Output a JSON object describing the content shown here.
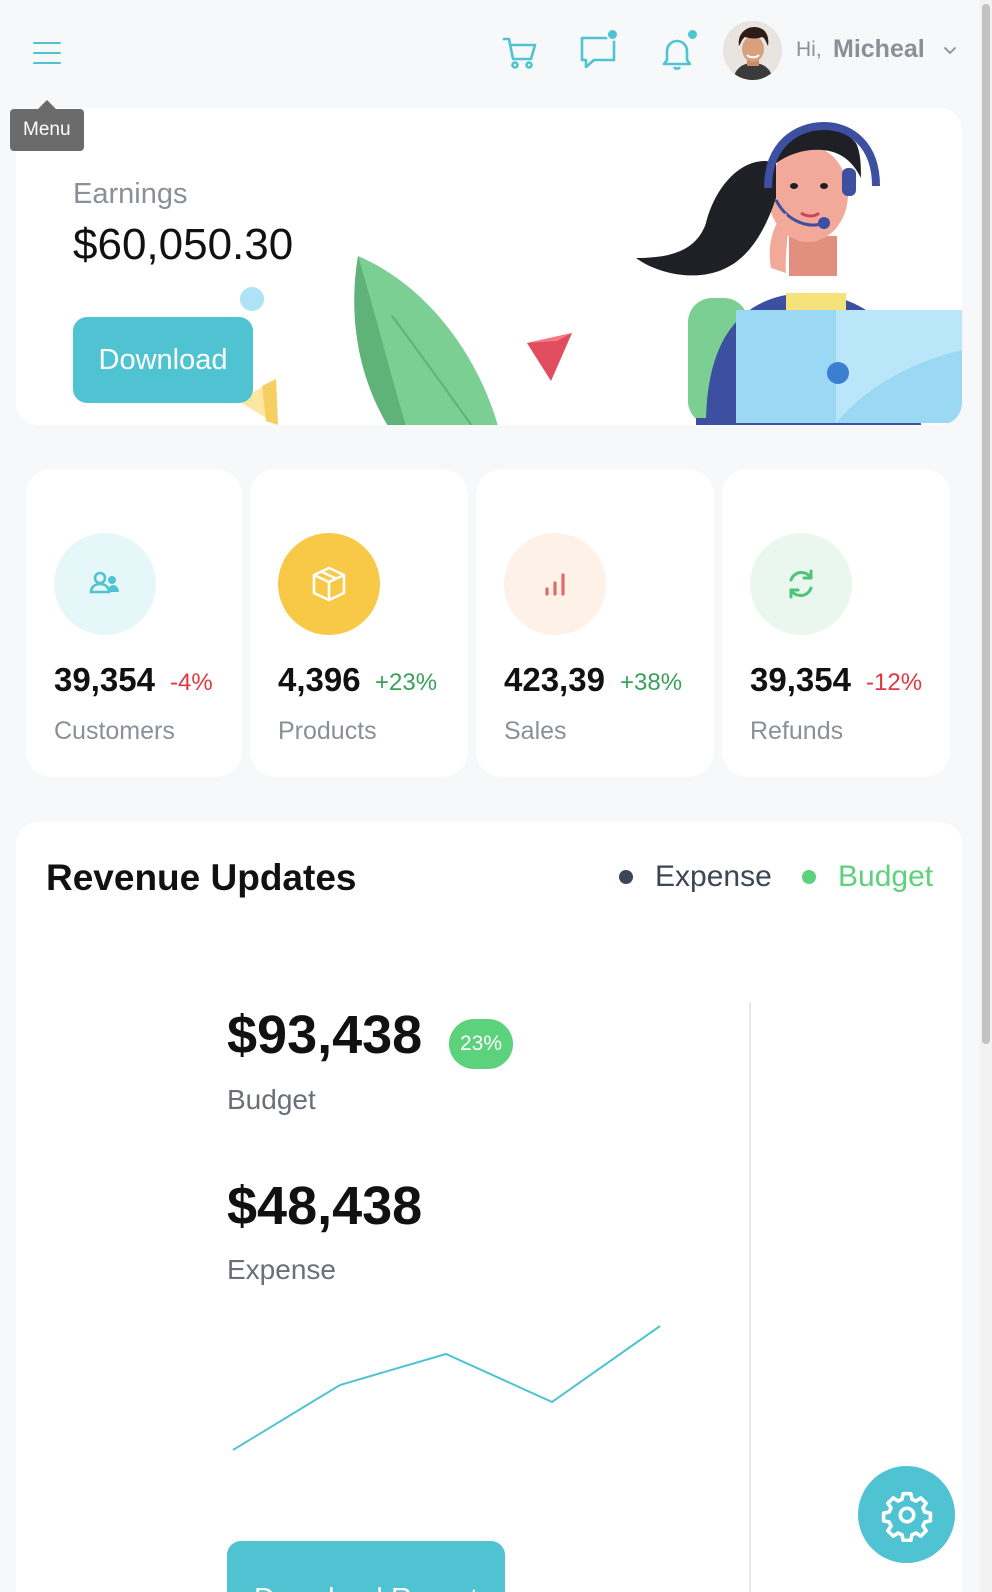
{
  "header": {
    "menu_tooltip": "Menu",
    "greeting": "Hi,",
    "user_name": "Micheal",
    "icons": [
      "menu-icon",
      "cart-icon",
      "chat-icon",
      "bell-icon",
      "chevron-down-icon"
    ],
    "accent": "#4fc3d2"
  },
  "earnings": {
    "title": "Earnings",
    "value": "$60,050.30",
    "button_label": "Download"
  },
  "stats": [
    {
      "value": "39,354",
      "change": "-4%",
      "label": "Customers",
      "icon": "users-icon",
      "icon_bg": "#e6f7f9",
      "icon_color": "#4fc3d2"
    },
    {
      "value": "4,396",
      "change": "+23%",
      "label": "Products",
      "icon": "box-icon",
      "icon_bg": "#f7c947",
      "icon_color": "#ffffff"
    },
    {
      "value": "423,39",
      "change": "+38%",
      "label": "Sales",
      "icon": "bar-chart-icon",
      "icon_bg": "#fdf1e8",
      "icon_color": "#e06a6a"
    },
    {
      "value": "39,354",
      "change": "-12%",
      "label": "Refunds",
      "icon": "refresh-icon",
      "icon_bg": "#eaf7ef",
      "icon_color": "#4cc57b"
    }
  ],
  "revenue": {
    "title": "Revenue Updates",
    "legend": [
      {
        "label": "Expense",
        "color": "#3c4657"
      },
      {
        "label": "Budget",
        "color": "#5bd27b"
      }
    ],
    "budget_value": "$93,438",
    "budget_badge": "23%",
    "budget_label": "Budget",
    "expense_value": "$48,438",
    "expense_label": "Expense",
    "button_label": "Download Report"
  },
  "settings_icon": "gear-icon"
}
